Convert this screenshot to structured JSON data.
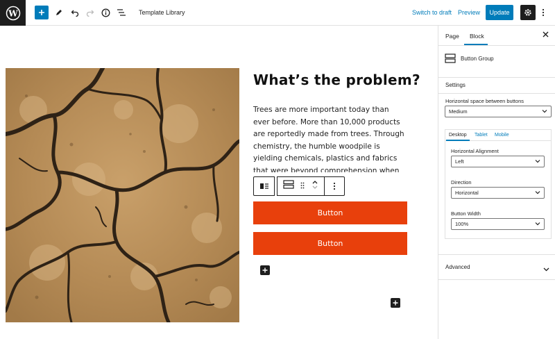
{
  "topbar": {
    "template_title": "Template Library",
    "switch_to_draft": "Switch to draft",
    "preview": "Preview",
    "update": "Update"
  },
  "content": {
    "heading": "What’s the problem?",
    "paragraph": "Trees are more important today than ever before. More than 10,000 products are reportedly made from trees. Through chemistry, the humble woodpile is yielding chemicals, plastics and fabrics that were beyond comprehension when an axe first",
    "buttons": [
      "Button",
      "Button"
    ]
  },
  "sidebar": {
    "tabs": [
      "Page",
      "Block"
    ],
    "active_tab": "Block",
    "block_name": "Button Group",
    "settings_label": "Settings",
    "horizontal_space_label": "Horizontal space between buttons",
    "horizontal_space_value": "Medium",
    "device_tabs": [
      "Desktop",
      "Tablet",
      "Mobile"
    ],
    "active_device": "Desktop",
    "alignment_label": "Horizontal Alignment",
    "alignment_value": "Left",
    "direction_label": "Direction",
    "direction_value": "Horizontal",
    "width_label": "Button Width",
    "width_value": "100%",
    "advanced_label": "Advanced"
  },
  "colors": {
    "accent": "#007cba",
    "button": "#e8400c",
    "dark": "#1e1e1e"
  }
}
